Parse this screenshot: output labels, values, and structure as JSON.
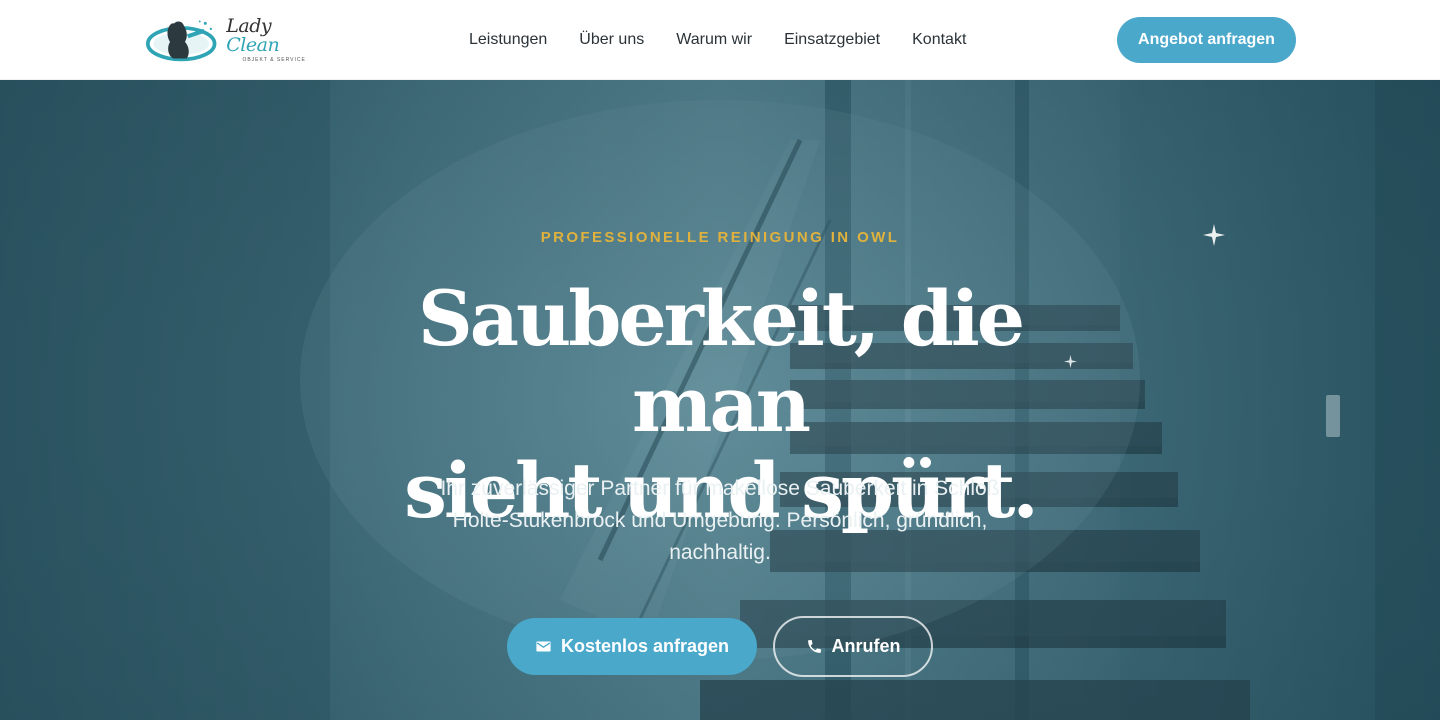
{
  "brand": {
    "name_part1": "Lady",
    "name_part2": "Clean",
    "tagline": "OBJEKT & SERVICE",
    "accent_color": "#2fa4b5"
  },
  "nav": {
    "items": [
      {
        "label": "Leistungen"
      },
      {
        "label": "Über uns"
      },
      {
        "label": "Warum wir"
      },
      {
        "label": "Einsatzgebiet"
      },
      {
        "label": "Kontakt"
      }
    ],
    "cta_label": "Angebot anfragen"
  },
  "hero": {
    "eyebrow": "PROFESSIONELLE REINIGUNG IN OWL",
    "headline_line1": "Sauberkeit, die man",
    "headline_line2": "sieht und spürt.",
    "subline": "Ihr zuverlässiger Partner für makellose Sauberkeit in Schloß Holte-Stukenbrock und Umgebung. Persönlich, gründlich, nachhaltig.",
    "primary_button": {
      "label": "Kostenlos anfragen",
      "icon": "mail-icon"
    },
    "secondary_button": {
      "label": "Anrufen",
      "icon": "phone-icon"
    }
  },
  "colors": {
    "primary": "#4aa8cb",
    "eyebrow": "#e0b23d",
    "hero_tint": "#3e6e7c"
  }
}
